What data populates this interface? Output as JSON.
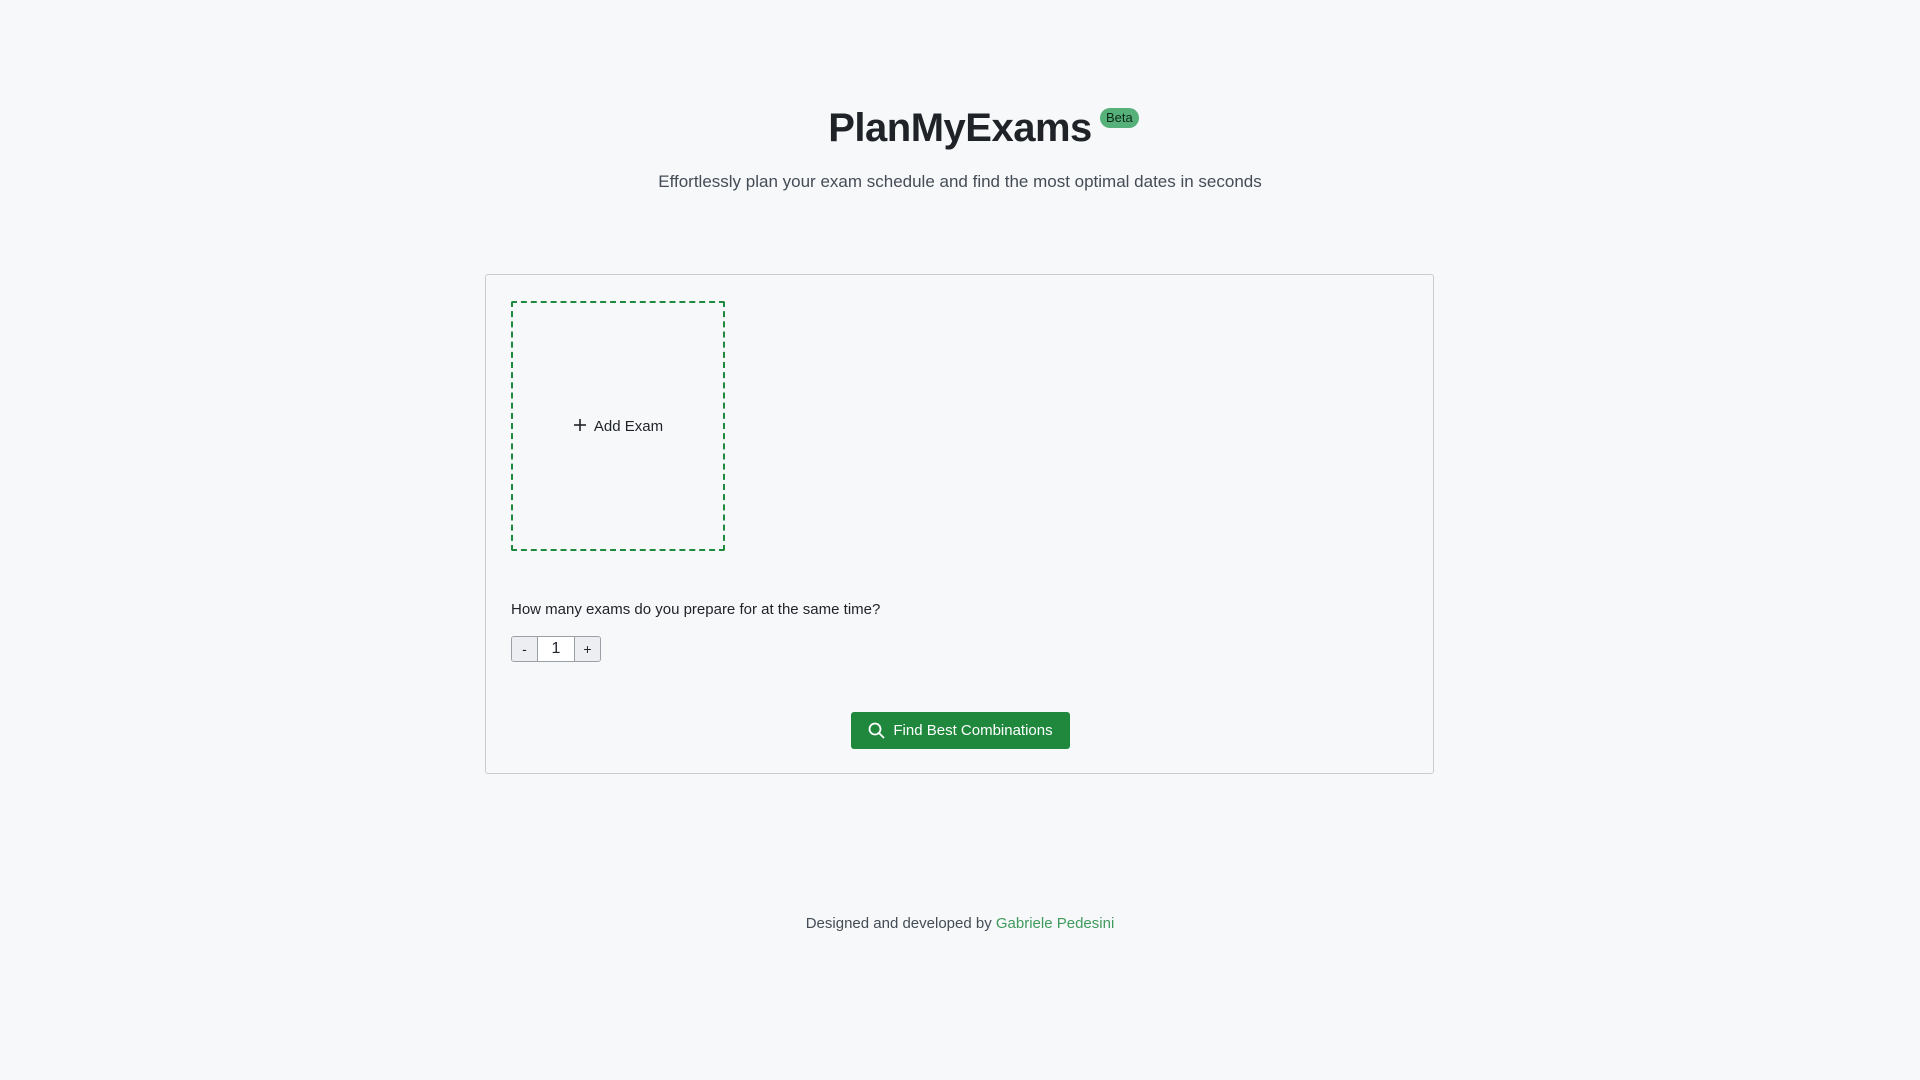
{
  "header": {
    "title": "PlanMyExams",
    "badge": "Beta",
    "subtitle": "Effortlessly plan your exam schedule and find the most optimal dates in seconds"
  },
  "card": {
    "add_exam_label": "Add Exam",
    "question": "How many exams do you prepare for at the same time?",
    "stepper": {
      "decrement_label": "-",
      "value": "1",
      "increment_label": "+"
    },
    "find_button_label": "Find Best Combinations"
  },
  "footer": {
    "text": "Designed and developed by",
    "author_link": "Gabriele Pedesini"
  },
  "colors": {
    "accent": "#1f883d",
    "badge_bg": "#56b07a",
    "link": "#3f9a5c",
    "background": "#f6f8fa"
  },
  "icons": {
    "add": "plus-icon",
    "find": "search-icon"
  }
}
